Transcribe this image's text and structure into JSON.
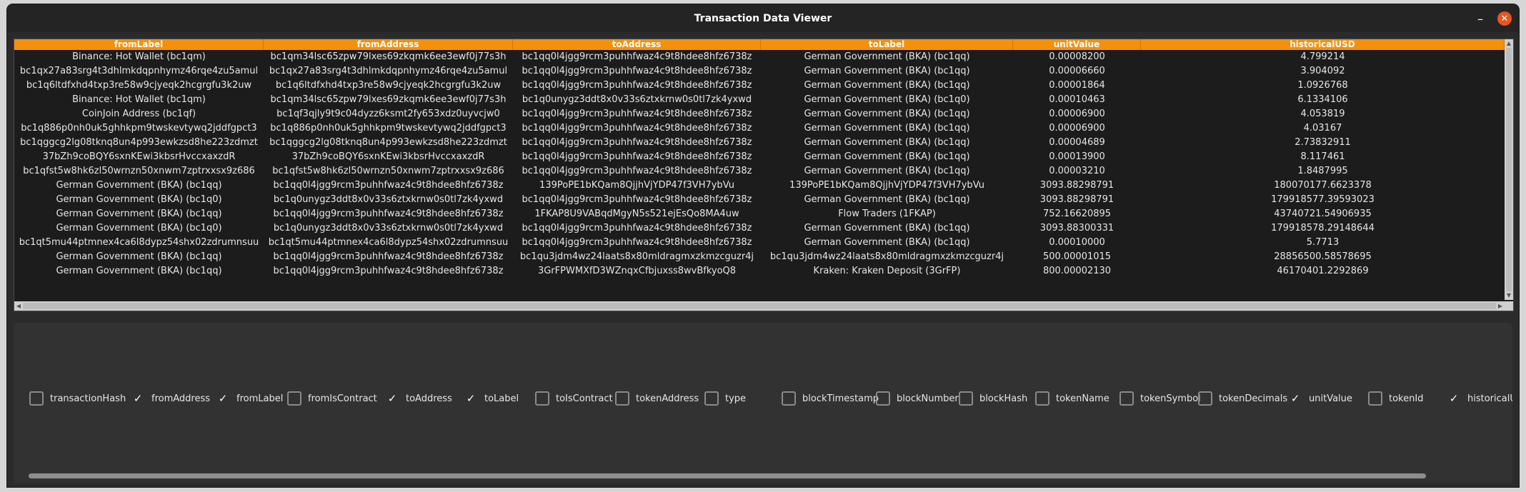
{
  "window": {
    "title": "Transaction Data Viewer",
    "minimize_icon": "minimize-icon",
    "close_icon": "close-icon",
    "close_color": "#e95420"
  },
  "table": {
    "header_color": "#f5900a",
    "columns": [
      "fromLabel",
      "fromAddress",
      "toAddress",
      "toLabel",
      "unitValue",
      "historicalUSD"
    ],
    "rows": [
      [
        "Binance: Hot Wallet (bc1qm)",
        "bc1qm34lsc65zpw79lxes69zkqmk6ee3ewf0j77s3h",
        "bc1qq0l4jgg9rcm3puhhfwaz4c9t8hdee8hfz6738z",
        "German Government (BKA) (bc1qq)",
        "0.00008200",
        "4.799214"
      ],
      [
        "bc1qx27a83srg4t3dhlmkdqpnhymz46rqe4zu5amul",
        "bc1qx27a83srg4t3dhlmkdqpnhymz46rqe4zu5amul",
        "bc1qq0l4jgg9rcm3puhhfwaz4c9t8hdee8hfz6738z",
        "German Government (BKA) (bc1qq)",
        "0.00006660",
        "3.904092"
      ],
      [
        "bc1q6ltdfxhd4txp3re58w9cjyeqk2hcgrgfu3k2uw",
        "bc1q6ltdfxhd4txp3re58w9cjyeqk2hcgrgfu3k2uw",
        "bc1qq0l4jgg9rcm3puhhfwaz4c9t8hdee8hfz6738z",
        "German Government (BKA) (bc1qq)",
        "0.00001864",
        "1.0926768"
      ],
      [
        "Binance: Hot Wallet (bc1qm)",
        "bc1qm34lsc65zpw79lxes69zkqmk6ee3ewf0j77s3h",
        "bc1q0unygz3ddt8x0v33s6ztxkrnw0s0tl7zk4yxwd",
        "German Government (BKA) (bc1q0)",
        "0.00010463",
        "6.1334106"
      ],
      [
        "CoinJoin Address (bc1qf)",
        "bc1qf3qjly9t9c04dyzz6ksmt2fy653xdz0uyvcjw0",
        "bc1qq0l4jgg9rcm3puhhfwaz4c9t8hdee8hfz6738z",
        "German Government (BKA) (bc1qq)",
        "0.00006900",
        "4.053819"
      ],
      [
        "bc1q886p0nh0uk5ghhkpm9twskevtywq2jddfgpct3",
        "bc1q886p0nh0uk5ghhkpm9twskevtywq2jddfgpct3",
        "bc1qq0l4jgg9rcm3puhhfwaz4c9t8hdee8hfz6738z",
        "German Government (BKA) (bc1qq)",
        "0.00006900",
        "4.03167"
      ],
      [
        "bc1qggcg2lg08tknq8un4p993ewkzsd8he223zdmzt",
        "bc1qggcg2lg08tknq8un4p993ewkzsd8he223zdmzt",
        "bc1qq0l4jgg9rcm3puhhfwaz4c9t8hdee8hfz6738z",
        "German Government (BKA) (bc1qq)",
        "0.00004689",
        "2.73832911"
      ],
      [
        "37bZh9coBQY6sxnKEwi3kbsrHvccxaxzdR",
        "37bZh9coBQY6sxnKEwi3kbsrHvccxaxzdR",
        "bc1qq0l4jgg9rcm3puhhfwaz4c9t8hdee8hfz6738z",
        "German Government (BKA) (bc1qq)",
        "0.00013900",
        "8.117461"
      ],
      [
        "bc1qfst5w8hk6zl50wrnzn50xnwm7zptrxxsx9z686",
        "bc1qfst5w8hk6zl50wrnzn50xnwm7zptrxxsx9z686",
        "bc1qq0l4jgg9rcm3puhhfwaz4c9t8hdee8hfz6738z",
        "German Government (BKA) (bc1qq)",
        "0.00003210",
        "1.8487995"
      ],
      [
        "German Government (BKA) (bc1qq)",
        "bc1qq0l4jgg9rcm3puhhfwaz4c9t8hdee8hfz6738z",
        "139PoPE1bKQam8QjjhVjYDP47f3VH7ybVu",
        "139PoPE1bKQam8QjjhVjYDP47f3VH7ybVu",
        "3093.88298791",
        "180070177.6623378"
      ],
      [
        "German Government (BKA) (bc1q0)",
        "bc1q0unygz3ddt8x0v33s6ztxkrnw0s0tl7zk4yxwd",
        "bc1qq0l4jgg9rcm3puhhfwaz4c9t8hdee8hfz6738z",
        "German Government (BKA) (bc1qq)",
        "3093.88298791",
        "179918577.39593023"
      ],
      [
        "German Government (BKA) (bc1qq)",
        "bc1qq0l4jgg9rcm3puhhfwaz4c9t8hdee8hfz6738z",
        "1FKAP8U9VABqdMgyN5s521ejEsQo8MA4uw",
        "Flow Traders (1FKAP)",
        "752.16620895",
        "43740721.54906935"
      ],
      [
        "German Government (BKA) (bc1q0)",
        "bc1q0unygz3ddt8x0v33s6ztxkrnw0s0tl7zk4yxwd",
        "bc1qq0l4jgg9rcm3puhhfwaz4c9t8hdee8hfz6738z",
        "German Government (BKA) (bc1qq)",
        "3093.88300331",
        "179918578.29148644"
      ],
      [
        "bc1qt5mu44ptmnex4ca6l8dypz54shx02zdrumnsuu",
        "bc1qt5mu44ptmnex4ca6l8dypz54shx02zdrumnsuu",
        "bc1qq0l4jgg9rcm3puhhfwaz4c9t8hdee8hfz6738z",
        "German Government (BKA) (bc1qq)",
        "0.00010000",
        "5.7713"
      ],
      [
        "German Government (BKA) (bc1qq)",
        "bc1qq0l4jgg9rcm3puhhfwaz4c9t8hdee8hfz6738z",
        "bc1qu3jdm4wz24laats8x80mldragmxzkmzcguzr4j",
        "bc1qu3jdm4wz24laats8x80mldragmxzkmzcguzr4j",
        "500.00001015",
        "28856500.58578695"
      ],
      [
        "German Government (BKA) (bc1qq)",
        "bc1qq0l4jgg9rcm3puhhfwaz4c9t8hdee8hfz6738z",
        "3GrFPWMXfD3WZnqxCfbjuxss8wvBfkyoQ8",
        "Kraken: Kraken Deposit (3GrFP)",
        "800.00002130",
        "46170401.2292869"
      ]
    ]
  },
  "column_toggles": [
    {
      "label": "transactionHash",
      "checked": false
    },
    {
      "label": "fromAddress",
      "checked": true
    },
    {
      "label": "fromLabel",
      "checked": true
    },
    {
      "label": "fromIsContract",
      "checked": false
    },
    {
      "label": "toAddress",
      "checked": true
    },
    {
      "label": "toLabel",
      "checked": true
    },
    {
      "label": "toIsContract",
      "checked": false
    },
    {
      "label": "tokenAddress",
      "checked": false
    },
    {
      "label": "type",
      "checked": false
    },
    {
      "label": "blockTimestamp",
      "checked": false
    },
    {
      "label": "blockNumber",
      "checked": false
    },
    {
      "label": "blockHash",
      "checked": false
    },
    {
      "label": "tokenName",
      "checked": false
    },
    {
      "label": "tokenSymbol",
      "checked": false
    },
    {
      "label": "tokenDecimals",
      "checked": false
    },
    {
      "label": "unitValue",
      "checked": true
    },
    {
      "label": "tokenId",
      "checked": false
    },
    {
      "label": "historicalUS",
      "checked": true
    }
  ],
  "check_mark": "✓"
}
